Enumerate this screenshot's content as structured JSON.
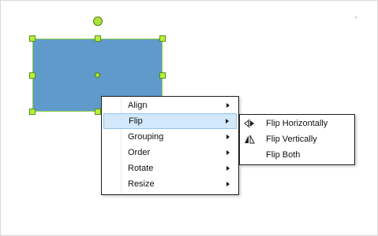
{
  "context_menu": {
    "items": [
      {
        "label": "Align",
        "has_submenu": true
      },
      {
        "label": "Flip",
        "has_submenu": true,
        "highlighted": true
      },
      {
        "label": "Grouping",
        "has_submenu": true
      },
      {
        "label": "Order",
        "has_submenu": true
      },
      {
        "label": "Rotate",
        "has_submenu": true
      },
      {
        "label": "Resize",
        "has_submenu": true
      }
    ]
  },
  "flip_submenu": {
    "items": [
      {
        "label": "Flip Horizontally",
        "icon": "flip-horizontal-icon"
      },
      {
        "label": "Flip Vertically",
        "icon": "flip-vertical-icon"
      },
      {
        "label": "Flip Both",
        "icon": ""
      }
    ]
  },
  "colors": {
    "shape_fill": "#5f9acb",
    "selection_handle": "#b6f03a",
    "menu_highlight": "#d2e9fb",
    "menu_highlight_border": "#90c4ef"
  }
}
